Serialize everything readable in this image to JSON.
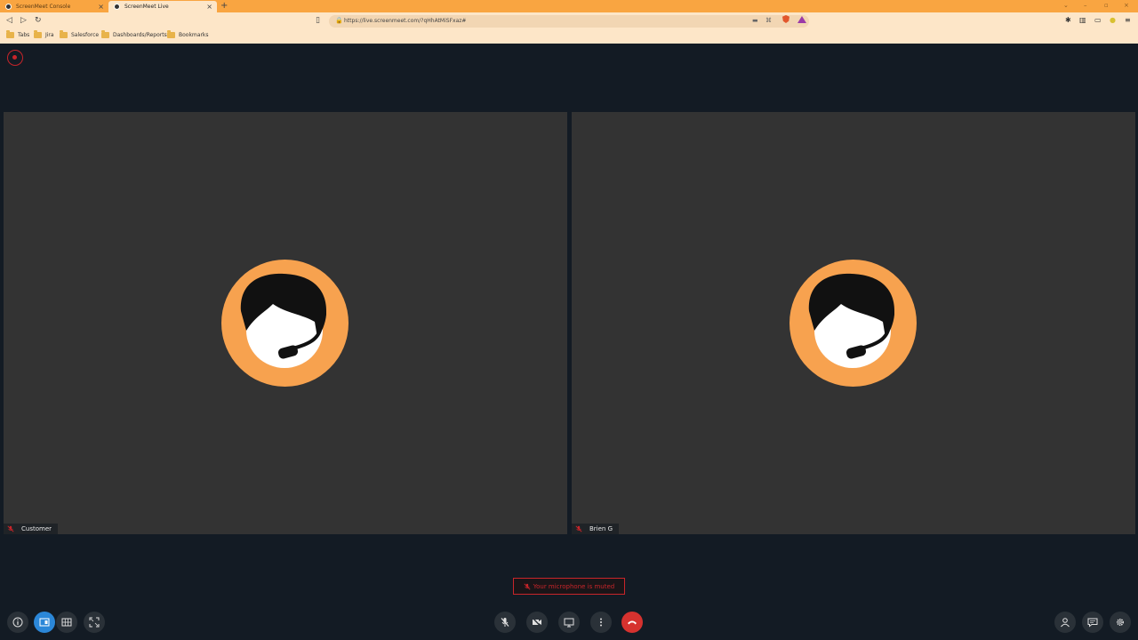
{
  "browser": {
    "tabs": [
      {
        "label": "ScreenMeet Console"
      },
      {
        "label": "ScreenMeet Live"
      }
    ],
    "url": "https://live.screenmeet.com/?qHhAtMiSFxaz#",
    "bookmarks": [
      "Tabs",
      "Jira",
      "Salesforce",
      "Dashboards/Reports",
      "Bookmarks"
    ]
  },
  "participants": [
    {
      "name": "Customer",
      "mic_muted": true
    },
    {
      "name": "Brien G",
      "mic_muted": true
    }
  ],
  "status": {
    "muted_message": "Your microphone is muted"
  },
  "colors": {
    "accent": "#f9a541",
    "danger": "#c8252a",
    "active": "#2b87d8",
    "avatar_ring": "#f7a24f"
  },
  "controls": {
    "left": [
      "info-icon",
      "speaker-view-icon",
      "grid-view-icon",
      "fullscreen-icon"
    ],
    "center": [
      "mic-off-icon",
      "camera-off-icon",
      "screen-share-icon",
      "more-icon",
      "hangup-icon"
    ],
    "right": [
      "participants-icon",
      "chat-icon",
      "settings-icon"
    ]
  }
}
